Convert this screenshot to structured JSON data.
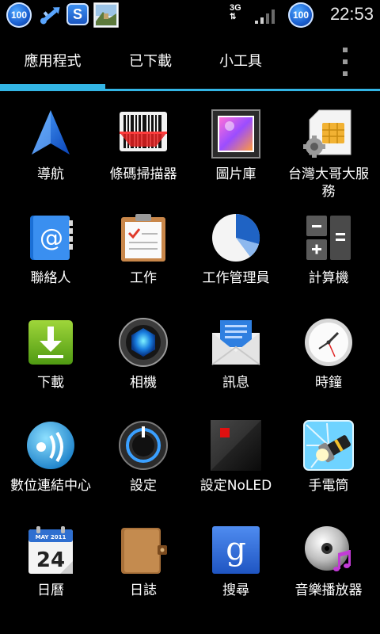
{
  "status_bar": {
    "left_badge_text": "100",
    "network_label": "3G",
    "right_badge_text": "100",
    "time": "22:53"
  },
  "tabs": [
    {
      "label": "應用程式",
      "selected": true
    },
    {
      "label": "已下載",
      "selected": false
    },
    {
      "label": "小工具",
      "selected": false
    }
  ],
  "apps": [
    {
      "label": "導航",
      "icon": "navigation-icon"
    },
    {
      "label": "條碼掃描器",
      "icon": "barcode-scanner-icon"
    },
    {
      "label": "圖片庫",
      "icon": "gallery-icon"
    },
    {
      "label": "台灣大哥大服務",
      "icon": "sim-service-icon"
    },
    {
      "label": "聯絡人",
      "icon": "contacts-icon"
    },
    {
      "label": "工作",
      "icon": "tasks-icon"
    },
    {
      "label": "工作管理員",
      "icon": "task-manager-icon"
    },
    {
      "label": "計算機",
      "icon": "calculator-icon"
    },
    {
      "label": "下載",
      "icon": "download-icon"
    },
    {
      "label": "相機",
      "icon": "camera-icon"
    },
    {
      "label": "訊息",
      "icon": "messaging-icon"
    },
    {
      "label": "時鐘",
      "icon": "clock-icon"
    },
    {
      "label": "數位連結中心",
      "icon": "digital-link-icon"
    },
    {
      "label": "設定",
      "icon": "settings-icon"
    },
    {
      "label": "設定NoLED",
      "icon": "noled-settings-icon"
    },
    {
      "label": "手電筒",
      "icon": "flashlight-icon"
    },
    {
      "label": "日曆",
      "icon": "calendar-icon",
      "month": "MAY 2011",
      "day": "24"
    },
    {
      "label": "日誌",
      "icon": "notes-icon"
    },
    {
      "label": "搜尋",
      "icon": "google-search-icon",
      "glyph": "g"
    },
    {
      "label": "音樂播放器",
      "icon": "music-player-icon"
    }
  ],
  "colors": {
    "accent": "#33b5e5",
    "background": "#000000"
  }
}
